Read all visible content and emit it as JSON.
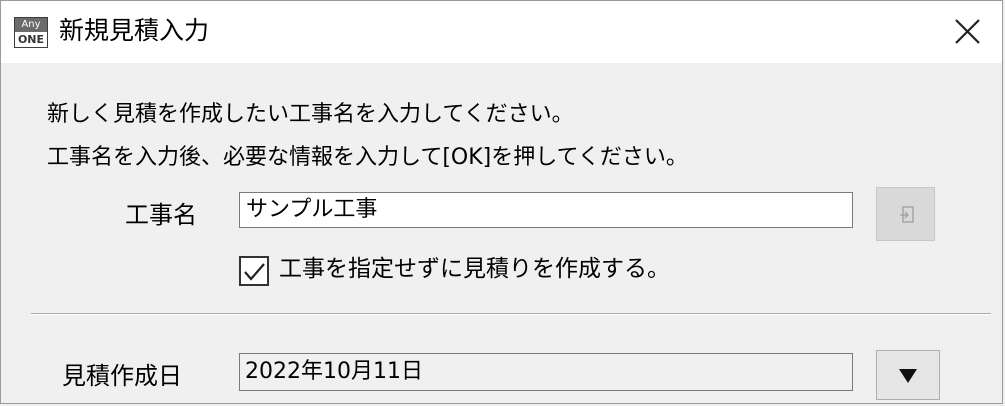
{
  "window": {
    "title": "新規見積入力",
    "icon": {
      "name": "anyone-app-icon",
      "text_top": "Any",
      "text_bottom": "ONE"
    },
    "close_icon": "close-icon"
  },
  "instructions": {
    "line1": "新しく見積を作成したい工事名を入力してください。",
    "line2": "工事名を入力後、必要な情報を入力して[OK]を押してください。"
  },
  "project": {
    "label": "工事名",
    "value": "サンプル工事",
    "picker_icon": "select-from-list-icon"
  },
  "skip_project": {
    "checked": true,
    "label": "工事を指定せずに見積りを作成する。"
  },
  "estimate_date": {
    "label": "見積作成日",
    "value": "2022年10月11日",
    "dropdown_icon": "dropdown-arrow-icon"
  }
}
